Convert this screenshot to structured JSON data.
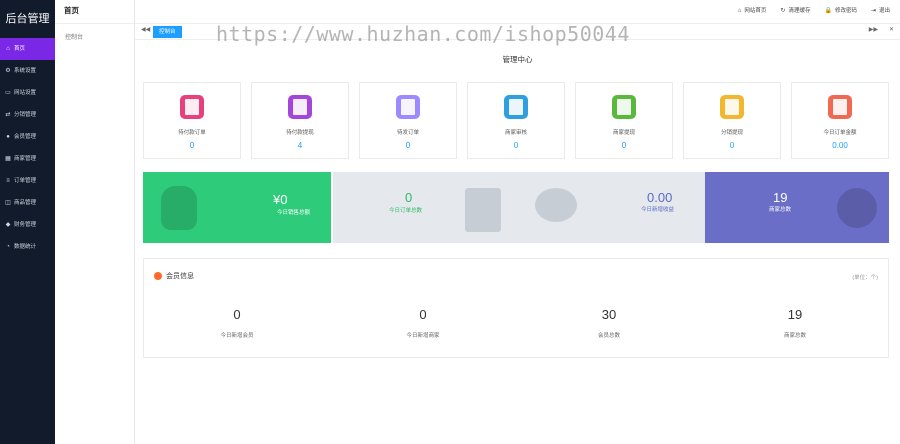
{
  "sidebar": {
    "brand": "后台管理",
    "items": [
      {
        "label": "首页",
        "icon": "house-icon",
        "glyph": "⌂",
        "active": true
      },
      {
        "label": "系统设置",
        "icon": "gear-icon",
        "glyph": "⚙"
      },
      {
        "label": "网站设置",
        "icon": "monitor-icon",
        "glyph": "▭"
      },
      {
        "label": "分销管理",
        "icon": "share-icon",
        "glyph": "⇄"
      },
      {
        "label": "会员管理",
        "icon": "user-icon",
        "glyph": "●"
      },
      {
        "label": "商家管理",
        "icon": "store-icon",
        "glyph": "▦"
      },
      {
        "label": "订单管理",
        "icon": "order-icon",
        "glyph": "≡"
      },
      {
        "label": "商品管理",
        "icon": "goods-icon",
        "glyph": "◫"
      },
      {
        "label": "财务管理",
        "icon": "finance-icon",
        "glyph": "◆"
      },
      {
        "label": "数据统计",
        "icon": "stats-icon",
        "glyph": "◔"
      }
    ]
  },
  "subnav": {
    "title": "首页",
    "item": "控制台"
  },
  "topbar": {
    "tools": [
      {
        "label": "网站首页",
        "icon": "home-icon",
        "glyph": "⌂"
      },
      {
        "label": "清理缓存",
        "icon": "refresh-icon",
        "glyph": "↻"
      },
      {
        "label": "修改密码",
        "icon": "lock-icon",
        "glyph": "🔒"
      },
      {
        "label": "退出",
        "icon": "logout-icon",
        "glyph": "⇥"
      }
    ]
  },
  "tabs": {
    "active": "控制台",
    "left_arrow": "◀◀",
    "right_arrow": "▶▶",
    "close": "✕"
  },
  "main": {
    "title": "管理中心",
    "stats": [
      {
        "label": "待付款订单",
        "value": "0",
        "color": "#e6407d",
        "icon": "document-icon"
      },
      {
        "label": "待付款提现",
        "value": "4",
        "color": "#a447d8",
        "icon": "money-bag-icon"
      },
      {
        "label": "待发订单",
        "value": "0",
        "color": "#9b8bff",
        "icon": "truck-icon"
      },
      {
        "label": "商家审核",
        "value": "0",
        "color": "#2f9fe0",
        "icon": "clipboard-check-icon"
      },
      {
        "label": "商家提现",
        "value": "0",
        "color": "#5ab93d",
        "icon": "notebook-icon"
      },
      {
        "label": "分销提现",
        "value": "0",
        "color": "#f2b62f",
        "icon": "wallet-icon"
      },
      {
        "label": "今日订单金额",
        "value": "0.00",
        "color": "#f06a51",
        "icon": "coin-icon"
      }
    ],
    "big_cards": [
      {
        "value": "¥0",
        "caption": "今日销售总额",
        "bg": "#2ecc7a",
        "fg": "#ffffff",
        "icon": "money-bag-icon"
      },
      {
        "value": "0",
        "caption": "今日订单总数",
        "bg": "#e5e9ed",
        "fg": "#2eb866",
        "icon": "document-icon"
      },
      {
        "value": "0.00",
        "caption": "今日新增收益",
        "bg": "#e5e9ed",
        "fg": "#5a6bc4",
        "icon": "chat-bubble-icon"
      },
      {
        "value": "19",
        "caption": "商家总数",
        "bg": "#6b6ec7",
        "fg": "#ffffff",
        "icon": "paw-icon"
      }
    ],
    "member": {
      "title": "会员信息",
      "unit": "(单位：个)",
      "cols": [
        {
          "value": "0",
          "caption": "今日新增会员"
        },
        {
          "value": "0",
          "caption": "今日新增商家"
        },
        {
          "value": "30",
          "caption": "会员总数"
        },
        {
          "value": "19",
          "caption": "商家总数"
        }
      ]
    }
  },
  "watermark": "https://www.huzhan.com/ishop50044"
}
